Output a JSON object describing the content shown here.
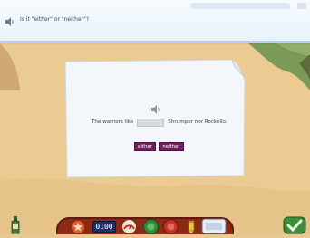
{
  "prompt": {
    "text": "Is it \"either\" or \"neither\"?"
  },
  "card": {
    "sentence_start": "The warriors like",
    "sentence_end": "Shrumper nor Rockello.",
    "options": [
      {
        "label": "either"
      },
      {
        "label": "neither"
      }
    ]
  },
  "toolbar": {
    "timer_value": "0100"
  },
  "colors": {
    "background_sand": "#ebcb92",
    "prompt_bar": "#eef5fc",
    "card": "#f3f6fa",
    "answer_button": "#6d1f5b",
    "tray": "#8a2a14",
    "timer": "#1d2f6b"
  },
  "icons": {
    "prompt_speaker": "speaker-icon",
    "card_speaker": "speaker-icon",
    "bottle": "bottle-icon",
    "star": "star-icon",
    "gauge": "gauge-icon",
    "green": "green-circle-icon",
    "red": "red-circle-icon",
    "pencil": "pencil-icon",
    "panel": "panel-icon",
    "check": "checkmark-icon"
  }
}
